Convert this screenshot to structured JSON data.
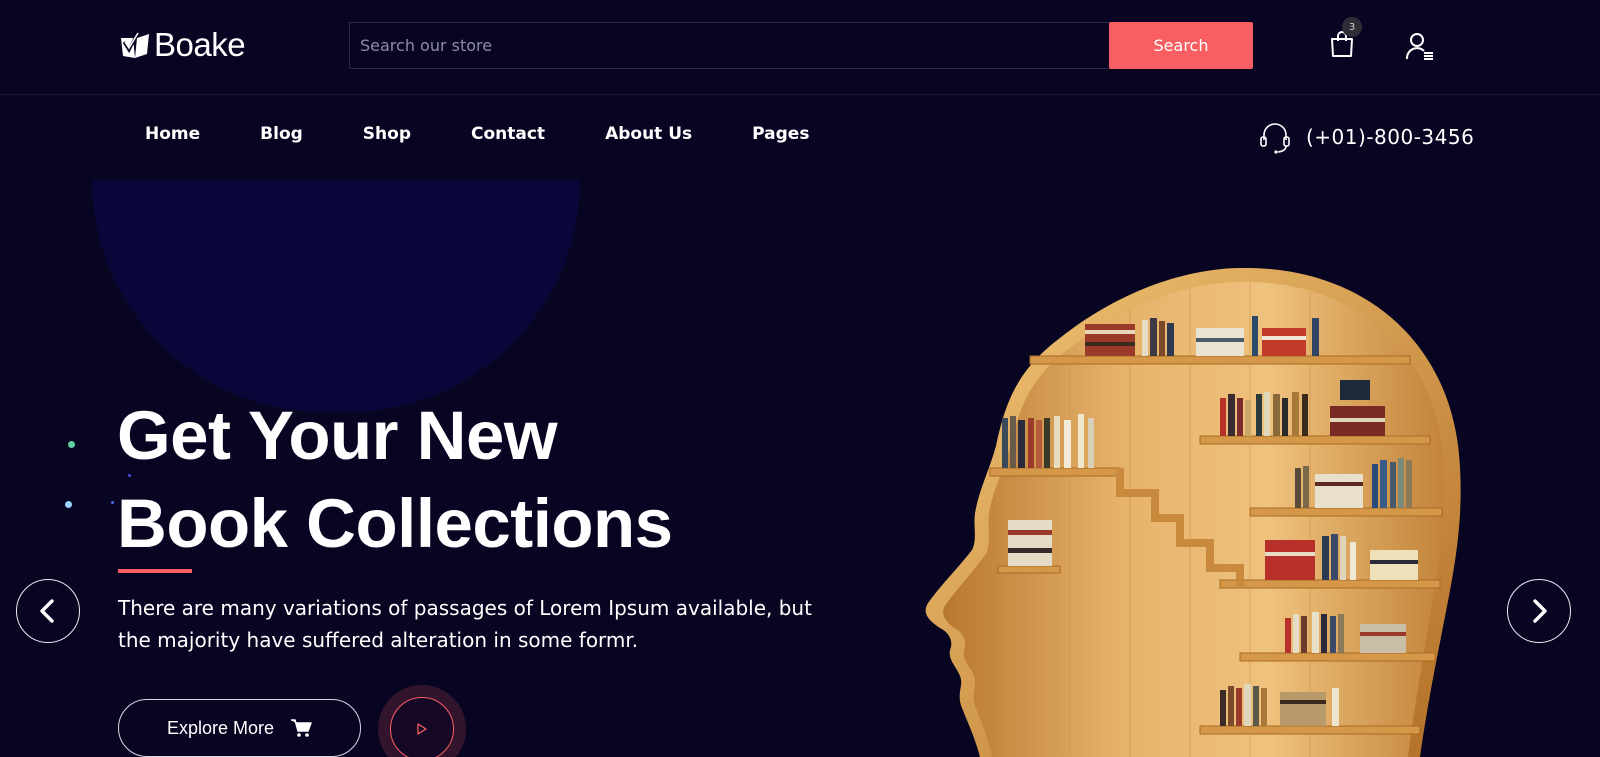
{
  "header": {
    "logo_text": "Boake",
    "search": {
      "placeholder": "Search our store",
      "value": "",
      "button_label": "Search"
    },
    "cart": {
      "icon": "shopping-bag-icon",
      "badge_count": "3"
    },
    "account": {
      "icon": "user-menu-icon"
    }
  },
  "nav": {
    "items": [
      {
        "label": "Home"
      },
      {
        "label": "Blog"
      },
      {
        "label": "Shop"
      },
      {
        "label": "Contact"
      },
      {
        "label": "About Us"
      },
      {
        "label": "Pages"
      }
    ],
    "phone": {
      "icon": "headset-icon",
      "number": "(+01)-800-3456"
    }
  },
  "hero": {
    "title_line1": "Get Your New",
    "title_line2": "Book Collections",
    "description_line1": "There are many variations of passages of Lorem Ipsum available, but",
    "description_line2": "the majority have suffered alteration in some formr.",
    "cta_label": "Explore More",
    "cta_icon": "cart-icon",
    "play_icon": "play-icon",
    "image": "head-shaped-bookshelf"
  },
  "carousel": {
    "prev_icon": "chevron-left-icon",
    "next_icon": "chevron-right-icon"
  },
  "colors": {
    "background": "#070522",
    "accent": "#f85e62",
    "text": "#ffffff"
  }
}
